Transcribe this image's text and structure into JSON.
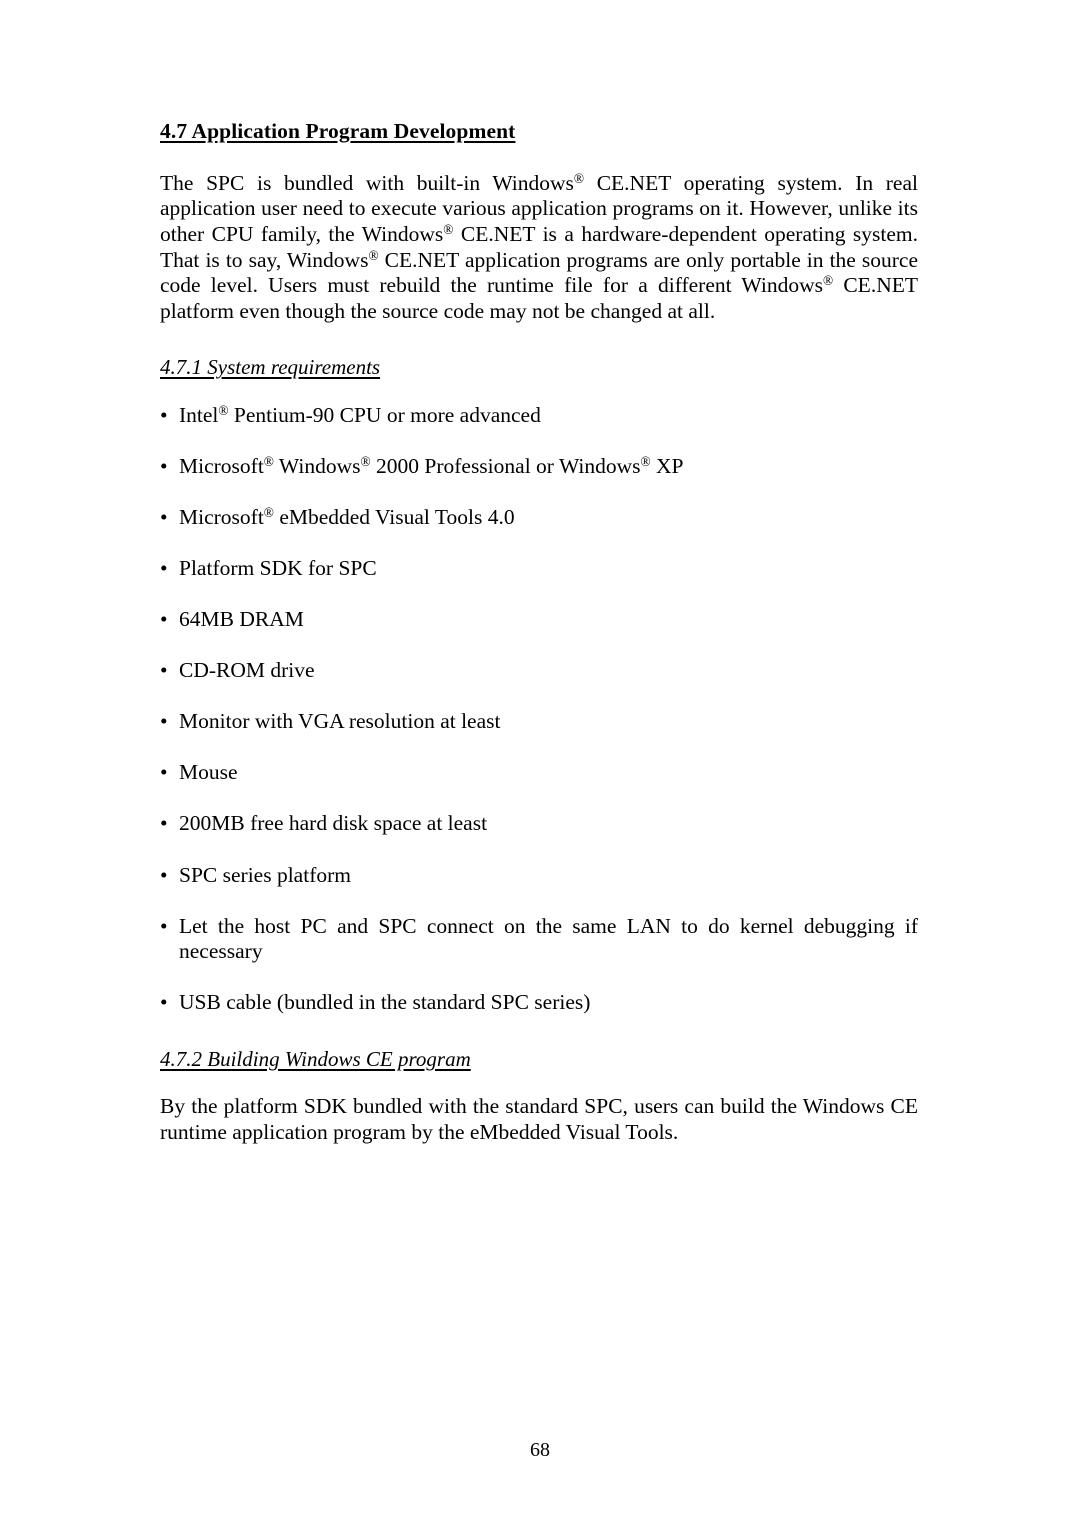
{
  "document": {
    "page_number": "68",
    "section_heading": "4.7 Application Program Development",
    "intro_paragraph": "The SPC is bundled with built-in Windows® CE.NET operating system. In real application user need to execute various application programs on it. However, unlike its other CPU family, the Windows® CE.NET is a hardware-dependent operating system. That is to say, Windows® CE.NET application programs are only portable in the source code level. Users must rebuild the runtime file for a different Windows® CE.NET platform even though the source code may not be changed at all.",
    "intro_segments": {
      "s1": "The SPC is bundled with built-in Windows",
      "s2": " CE.NET operating system. In real application user need to execute various application programs on it. However, unlike its other CPU family, the Windows",
      "s3": " CE.NET is a hardware-dependent operating system. That is to say, Windows",
      "s4": " CE.NET application programs are only portable in the source code level. Users must rebuild the runtime file for a different Windows",
      "s5": " CE.NET platform even though the source code may not be changed at all."
    },
    "subsection_1": {
      "heading": "4.7.1 System requirements",
      "bullets": [
        {
          "id": "intel-cpu",
          "pre": "Intel",
          "reg": "®",
          "post": " Pentium-90 CPU or more advanced",
          "text": "Intel® Pentium-90 CPU or more advanced"
        },
        {
          "id": "operating-system",
          "text": "Microsoft® Windows® 2000 Professional or Windows® XP"
        },
        {
          "id": "embedded-visual-tools",
          "pre": "Microsoft",
          "reg": "®",
          "post": " eMbedded Visual Tools 4.0",
          "text": "Microsoft® eMbedded Visual Tools 4.0"
        },
        {
          "id": "platform-sdk",
          "text": "Platform SDK for SPC"
        },
        {
          "id": "dram",
          "text": "64MB DRAM"
        },
        {
          "id": "cdrom-drive",
          "text": "CD-ROM drive"
        },
        {
          "id": "monitor",
          "text": "Monitor with VGA resolution at least"
        },
        {
          "id": "mouse",
          "text": "Mouse"
        },
        {
          "id": "hard-disk-space",
          "text": "200MB free hard disk space at least"
        },
        {
          "id": "spc-series-platform",
          "text": "SPC series platform"
        },
        {
          "id": "lan-kernel-debugging",
          "text": "Let the host PC and SPC connect on the same LAN to do kernel debugging if necessary"
        },
        {
          "id": "usb-cable",
          "text": "USB cable (bundled in the standard SPC series)"
        }
      ],
      "os_bullet_segments": {
        "s1": "Microsoft",
        "s2": " Windows",
        "s3": " 2000 Professional or Windows",
        "s4": " XP"
      },
      "registered_mark": "®"
    },
    "subsection_2": {
      "heading": "4.7.2 Building Windows CE program",
      "paragraph": "By the platform SDK bundled with the standard SPC, users can build the Windows CE runtime application program by the eMbedded Visual Tools."
    }
  }
}
